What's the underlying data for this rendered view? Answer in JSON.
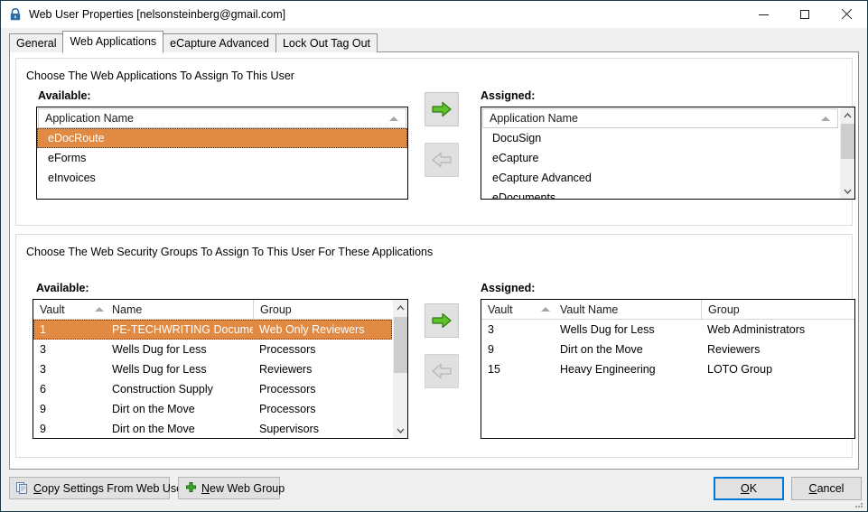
{
  "window": {
    "title": "Web User Properties [nelsonsteinberg@gmail.com]",
    "icon": "lock-icon",
    "controls": {
      "minimize": "minimize-icon",
      "maximize": "maximize-icon",
      "close": "close-icon"
    }
  },
  "tabs": [
    {
      "label": "General",
      "active": false
    },
    {
      "label": "Web Applications",
      "active": true
    },
    {
      "label": "eCapture Advanced",
      "active": false
    },
    {
      "label": "Lock Out Tag Out",
      "active": false
    }
  ],
  "applications_section": {
    "instruction": "Choose The Web Applications To Assign To This User",
    "available_label": "Available:",
    "assigned_label": "Assigned:",
    "available": {
      "header": "Application Name",
      "sort": "ascending",
      "rows": [
        {
          "name": "eDocRoute",
          "selected": true
        },
        {
          "name": "eForms",
          "selected": false
        },
        {
          "name": "eInvoices",
          "selected": false
        }
      ]
    },
    "assigned": {
      "header": "Application Name",
      "sort": "ascending",
      "rows": [
        {
          "name": "DocuSign"
        },
        {
          "name": "eCapture"
        },
        {
          "name": "eCapture Advanced"
        },
        {
          "name": "eDocuments"
        }
      ],
      "scrollbar": {
        "up": "chevron-up-icon",
        "down": "chevron-down-icon",
        "thumb_top_pct": 2,
        "thumb_height_pct": 58
      }
    },
    "add_button": "arrow-right-icon",
    "remove_button": "arrow-left-icon",
    "remove_disabled": true
  },
  "groups_section": {
    "instruction": "Choose The Web Security Groups To Assign To This User For These Applications",
    "available_label": "Available:",
    "assigned_label": "Assigned:",
    "available": {
      "columns": [
        "Vault",
        "Name",
        "Group"
      ],
      "sort_column": "Vault",
      "sort": "ascending",
      "rows": [
        {
          "vault": "1",
          "name": "PE-TECHWRITING Documents",
          "group": "Web Only Reviewers",
          "selected": true
        },
        {
          "vault": "3",
          "name": "Wells Dug for Less",
          "group": "Processors",
          "selected": false
        },
        {
          "vault": "3",
          "name": "Wells Dug for Less",
          "group": "Reviewers",
          "selected": false
        },
        {
          "vault": "6",
          "name": "Construction Supply",
          "group": "Processors",
          "selected": false
        },
        {
          "vault": "9",
          "name": "Dirt on the Move",
          "group": "Processors",
          "selected": false
        },
        {
          "vault": "9",
          "name": "Dirt on the Move",
          "group": "Supervisors",
          "selected": false
        }
      ],
      "scrollbar": {
        "up": "chevron-up-icon",
        "down": "chevron-down-icon",
        "thumb_top_pct": 2,
        "thumb_height_pct": 52
      }
    },
    "assigned": {
      "columns": [
        "Vault",
        "Vault Name",
        "Group"
      ],
      "sort_column": "Vault",
      "sort": "ascending",
      "rows": [
        {
          "vault": "3",
          "name": "Wells Dug for Less",
          "group": "Web Administrators"
        },
        {
          "vault": "9",
          "name": "Dirt on the Move",
          "group": "Reviewers"
        },
        {
          "vault": "15",
          "name": "Heavy Engineering",
          "group": "LOTO Group"
        }
      ]
    },
    "add_button": "arrow-right-icon",
    "remove_button": "arrow-left-icon",
    "remove_disabled": true
  },
  "footer": {
    "copy_settings": {
      "pre": "C",
      "rest": "opy Settings From Web User",
      "icon": "copy-document-icon"
    },
    "new_web_group": {
      "pre": "N",
      "rest": "ew Web Group",
      "icon": "plus-icon"
    },
    "ok": {
      "pre": "O",
      "rest": "K"
    },
    "cancel": {
      "pre": "C",
      "rest": "ancel"
    }
  },
  "colors": {
    "selection": "#e08a43",
    "accent_default_button": "#0078d7",
    "arrow_green": "#5ec32a",
    "title_bar": "#ffffff"
  }
}
